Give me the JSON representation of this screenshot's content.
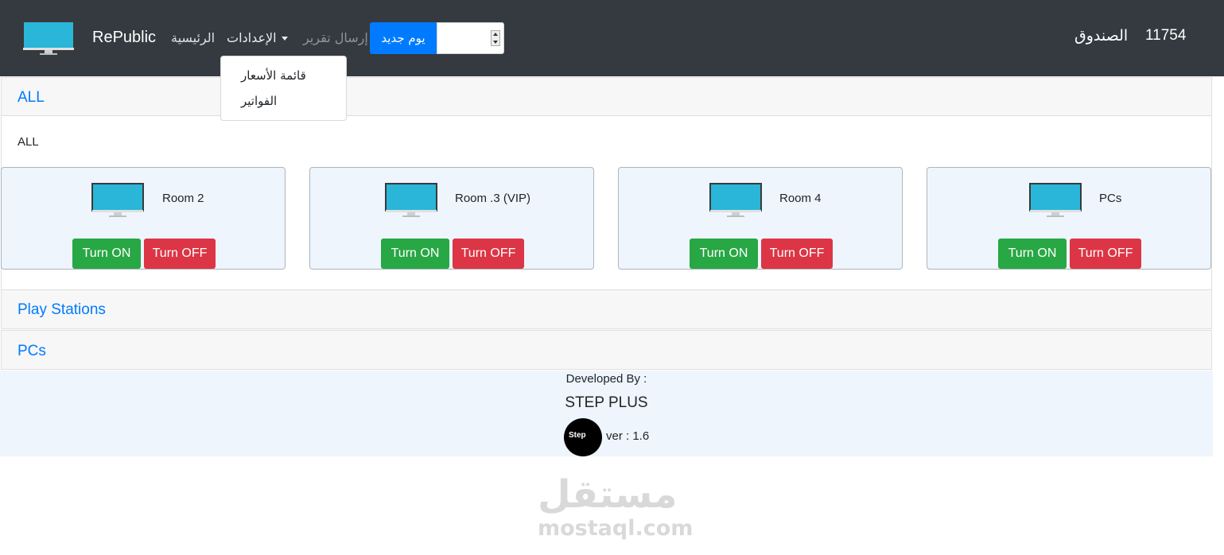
{
  "navbar": {
    "brand": "RePublic",
    "home": "الرئيسية",
    "settings": "الإعدادات",
    "send_report": "إرسال تقرير",
    "new_day": "يوم جديد",
    "day_value": "",
    "safe_label": "الصندوق",
    "safe_value": "11754"
  },
  "settings_menu": {
    "items": [
      {
        "label": "قائمة الأسعار"
      },
      {
        "label": "الفواتير"
      }
    ]
  },
  "sections": {
    "all": {
      "title": "ALL",
      "inner_label": "ALL"
    },
    "play_stations": {
      "title": "Play Stations"
    },
    "pcs": {
      "title": "PCs"
    }
  },
  "rooms": [
    {
      "name": "Room 2",
      "on_label": "Turn ON",
      "off_label": "Turn OFF"
    },
    {
      "name": "Room .3 (VIP)",
      "on_label": "Turn ON",
      "off_label": "Turn OFF"
    },
    {
      "name": "Room 4",
      "on_label": "Turn ON",
      "off_label": "Turn OFF"
    },
    {
      "name": "PCs",
      "on_label": "Turn ON",
      "off_label": "Turn OFF"
    }
  ],
  "footer": {
    "developed_by": "Developed By :",
    "company": "STEP PLUS",
    "logo_text": "Step",
    "version": "ver : 1.6"
  },
  "watermark": {
    "arabic": "مستقل",
    "latin": "mostaql.com"
  },
  "colors": {
    "navbar": "#343a40",
    "primary": "#007bff",
    "success": "#28a745",
    "danger": "#dc3545",
    "monitor_screen": "#29b6d8"
  }
}
